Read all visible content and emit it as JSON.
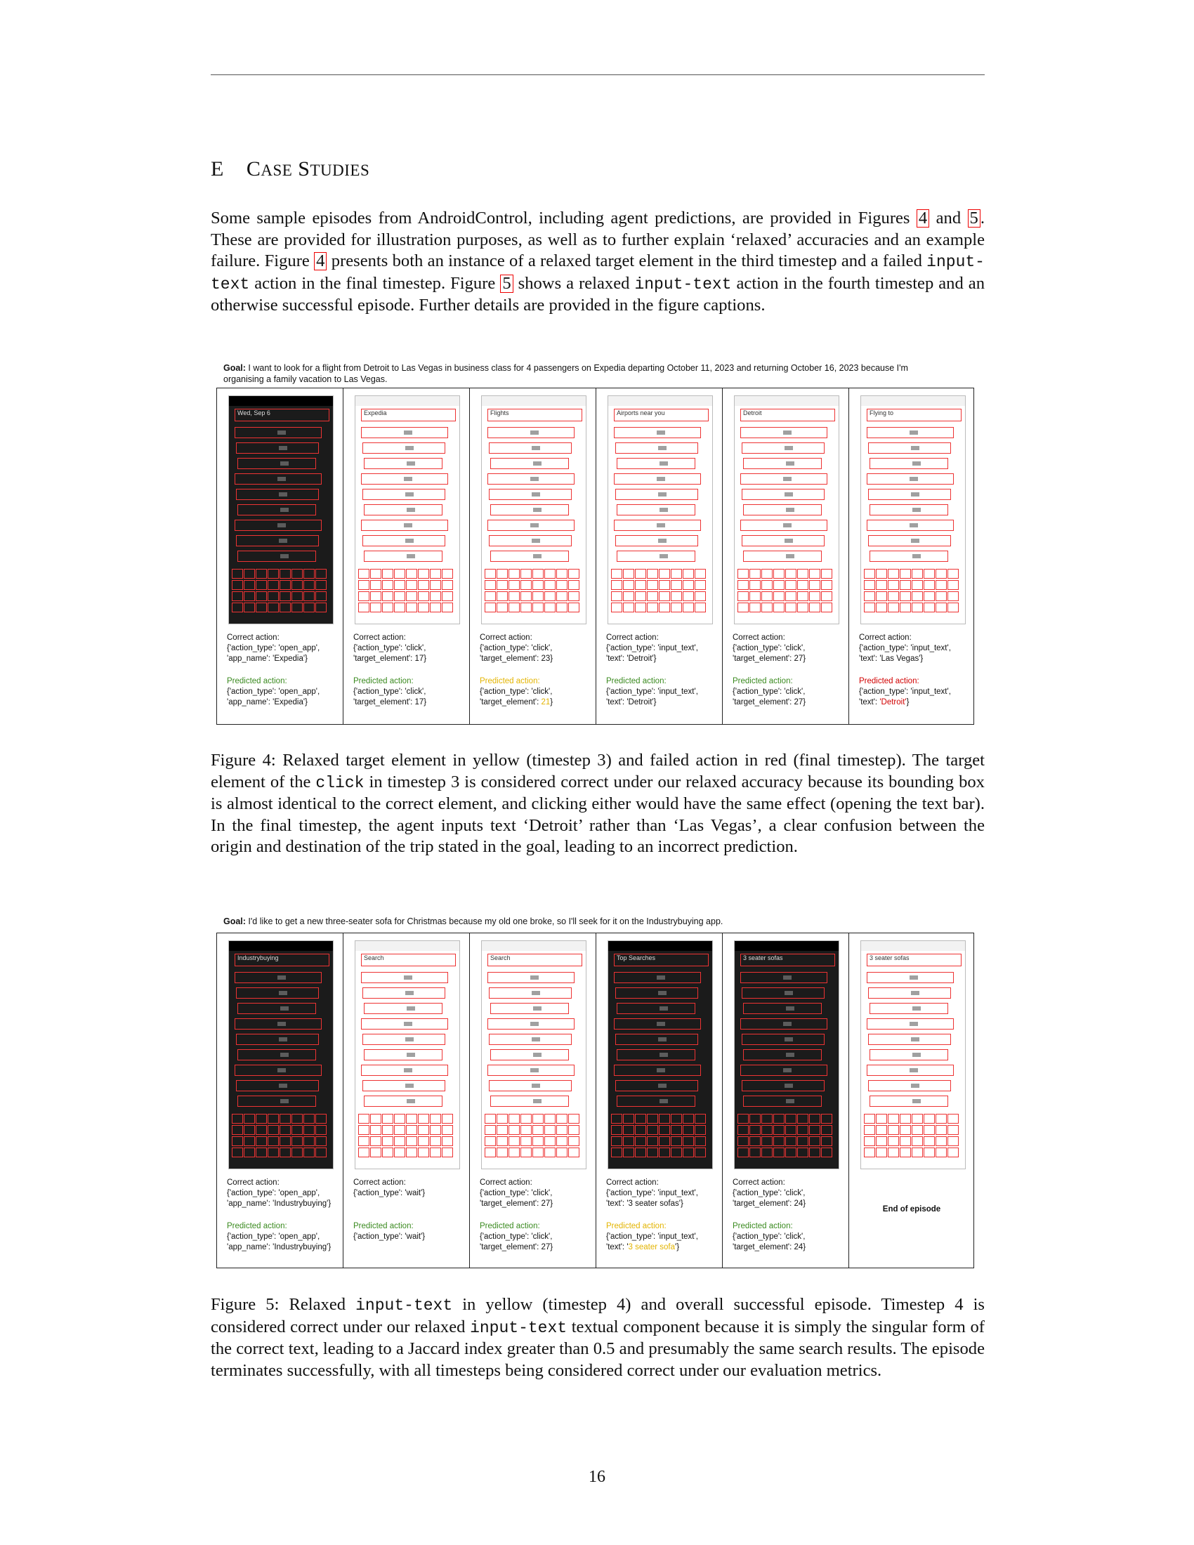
{
  "section": {
    "letter": "E",
    "title_cap1": "C",
    "title_rest1": "ASE",
    "title_cap2": "S",
    "title_rest2": "TUDIES"
  },
  "intro": {
    "t1": "Some sample episodes from AndroidControl, including agent predictions, are provided in Figures ",
    "ref4": "4",
    "t2": " and ",
    "ref5": "5",
    "t3": ". These are provided for illustration purposes, as well as to further explain ‘relaxed’ accuracies and an example failure.  Figure ",
    "t4": " presents both an instance of a relaxed target element in the third timestep and a failed ",
    "code1": "input-text",
    "t5": " action in the final timestep.  Figure ",
    "t6": " shows a relaxed ",
    "code2": "input-text",
    "t7": " action in the fourth timestep and an otherwise successful episode. Further details are provided in the figure captions."
  },
  "fig4": {
    "goal_label": "Goal:",
    "goal_text": " I want to look for a flight from Detroit to Las Vegas in business class for 4 passengers on Expedia departing October 11, 2023 and returning October 16, 2023 because I'm organising a family vacation to Las Vegas.",
    "columns": [
      {
        "correct_head": "Correct action:",
        "correct": "{'action_type': 'open_app', 'app_name': 'Expedia'}",
        "pred_head": "Predicted action:",
        "pred": "{'action_type': 'open_app', 'app_name': 'Expedia'}",
        "pred_color": "green"
      },
      {
        "correct_head": "Correct action:",
        "correct": "{'action_type': 'click', 'target_element': 17}",
        "pred_head": "Predicted action:",
        "pred": "{'action_type': 'click', 'target_element': 17}",
        "pred_color": "green"
      },
      {
        "correct_head": "Correct action:",
        "correct": "{'action_type': 'click', 'target_element': 23}",
        "pred_head": "Predicted action:",
        "pred_pre": "{'action_type': 'click', 'target_element': ",
        "pred_hl": "21",
        "pred_post": "}",
        "pred_color": "yellow"
      },
      {
        "correct_head": "Correct action:",
        "correct": "{'action_type': 'input_text', 'text': 'Detroit'}",
        "pred_head": "Predicted action:",
        "pred": "{'action_type': 'input_text', 'text': 'Detroit'}",
        "pred_color": "green"
      },
      {
        "correct_head": "Correct action:",
        "correct": "{'action_type': 'click', 'target_element': 27}",
        "pred_head": "Predicted action:",
        "pred": "{'action_type': 'click', 'target_element': 27}",
        "pred_color": "green"
      },
      {
        "correct_head": "Correct action:",
        "correct": "{'action_type': 'input_text', 'text': 'Las Vegas'}",
        "pred_head": "Predicted action:",
        "pred_pre": "{'action_type': 'input_text', 'text': ",
        "pred_hl": "'Detroit'",
        "pred_post": "}",
        "pred_color": "red"
      }
    ],
    "caption": {
      "c1": "Figure 4: Relaxed target element in yellow (timestep 3) and failed action in red (final timestep). The target element of the ",
      "code": "click",
      "c2": " in timestep 3 is considered correct under our relaxed accuracy because its bounding box is almost identical to the correct element, and clicking either would have the same effect (opening the text bar). In the final timestep, the agent inputs text ‘Detroit’ rather than ‘Las Vegas’, a clear confusion between the origin and destination of the trip stated in the goal, leading to an incorrect prediction."
    }
  },
  "fig5": {
    "goal_label": "Goal:",
    "goal_text": " I'd like to get a new three-seater sofa for Christmas because my old one broke, so I'll seek for it on the Industrybuying app.",
    "columns": [
      {
        "correct_head": "Correct action:",
        "correct": "{'action_type': 'open_app', 'app_name': 'Industrybuying'}",
        "pred_head": "Predicted action:",
        "pred": "{'action_type': 'open_app', 'app_name': 'Industrybuying'}",
        "pred_color": "green"
      },
      {
        "correct_head": "Correct action:",
        "correct": "{'action_type': 'wait'}",
        "pred_head": "Predicted action:",
        "pred": "{'action_type': 'wait'}",
        "pred_color": "green"
      },
      {
        "correct_head": "Correct action:",
        "correct": "{'action_type': 'click', 'target_element': 27}",
        "pred_head": "Predicted action:",
        "pred": "{'action_type': 'click', 'target_element': 27}",
        "pred_color": "green"
      },
      {
        "correct_head": "Correct action:",
        "correct": "{'action_type': 'input_text', 'text': '3 seater sofas'}",
        "pred_head": "Predicted action:",
        "pred_pre": "{'action_type': 'input_text', 'text': '",
        "pred_hl": "3 seater sofa",
        "pred_post": "'}",
        "pred_color": "yellow"
      },
      {
        "correct_head": "Correct action:",
        "correct": "{'action_type': 'click', 'target_element': 24}",
        "pred_head": "Predicted action:",
        "pred": "{'action_type': 'click', 'target_element': 24}",
        "pred_color": "green"
      },
      {
        "end": "End of episode"
      }
    ],
    "caption": {
      "c1": "Figure 5: Relaxed ",
      "code1": "input-text",
      "c2": " in yellow (timestep 4) and overall successful episode. Timestep 4 is considered correct under our relaxed ",
      "code2": "input-text",
      "c3": " textual component because it is simply the singular form of the correct text, leading to a Jaccard index greater than 0.5 and presumably the same search results. The episode terminates successfully, with all timesteps being considered correct under our evaluation metrics."
    }
  },
  "screens4": [
    "Wed, Sep 6",
    "Expedia",
    "Flights",
    "Airports near you",
    "Detroit",
    "Flying to"
  ],
  "screens5": [
    "Industrybuying",
    "Search",
    "Search",
    "Top Searches",
    "3 seater sofas",
    "3 seater sofas"
  ],
  "page_number": "16"
}
